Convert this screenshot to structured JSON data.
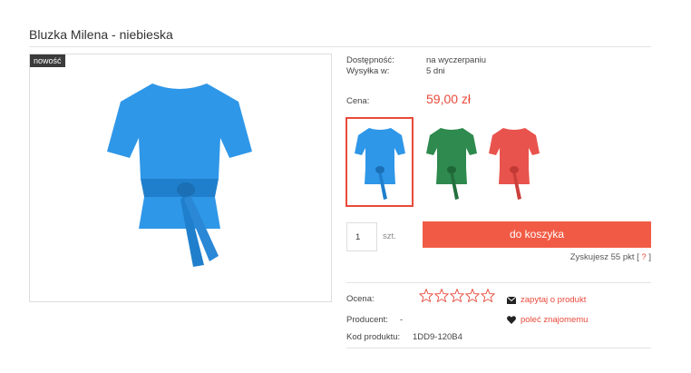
{
  "product": {
    "title": "Bluzka Milena - niebieska",
    "badge": "nowość"
  },
  "availability": {
    "label": "Dostępność:",
    "value": "na wyczerpaniu"
  },
  "shipping": {
    "label": "Wysyłka w:",
    "value": "5 dni"
  },
  "price": {
    "label": "Cena:",
    "value": "59,00 zł"
  },
  "variants": [
    {
      "name": "niebieska",
      "color": "#2f97e8"
    },
    {
      "name": "zielona",
      "color": "#2e8a4e"
    },
    {
      "name": "czerwona",
      "color": "#e9534d"
    }
  ],
  "cart": {
    "quantity": "1",
    "unit": "szt.",
    "button_label": "do koszyka",
    "points_text": "Zyskujesz 55 pkt [",
    "points_help": "?",
    "points_close": "]"
  },
  "rating": {
    "label": "Ocena:",
    "stars_filled": 0,
    "stars_total": 5
  },
  "producer": {
    "label": "Producent:",
    "value": "-"
  },
  "code": {
    "label": "Kod produktu:",
    "value": "1DD9-120B4"
  },
  "actions": {
    "ask": "zapytaj o produkt",
    "recommend": "poleć znajomemu"
  },
  "colors": {
    "accent": "#e84a3b",
    "button": "#f15b45"
  }
}
